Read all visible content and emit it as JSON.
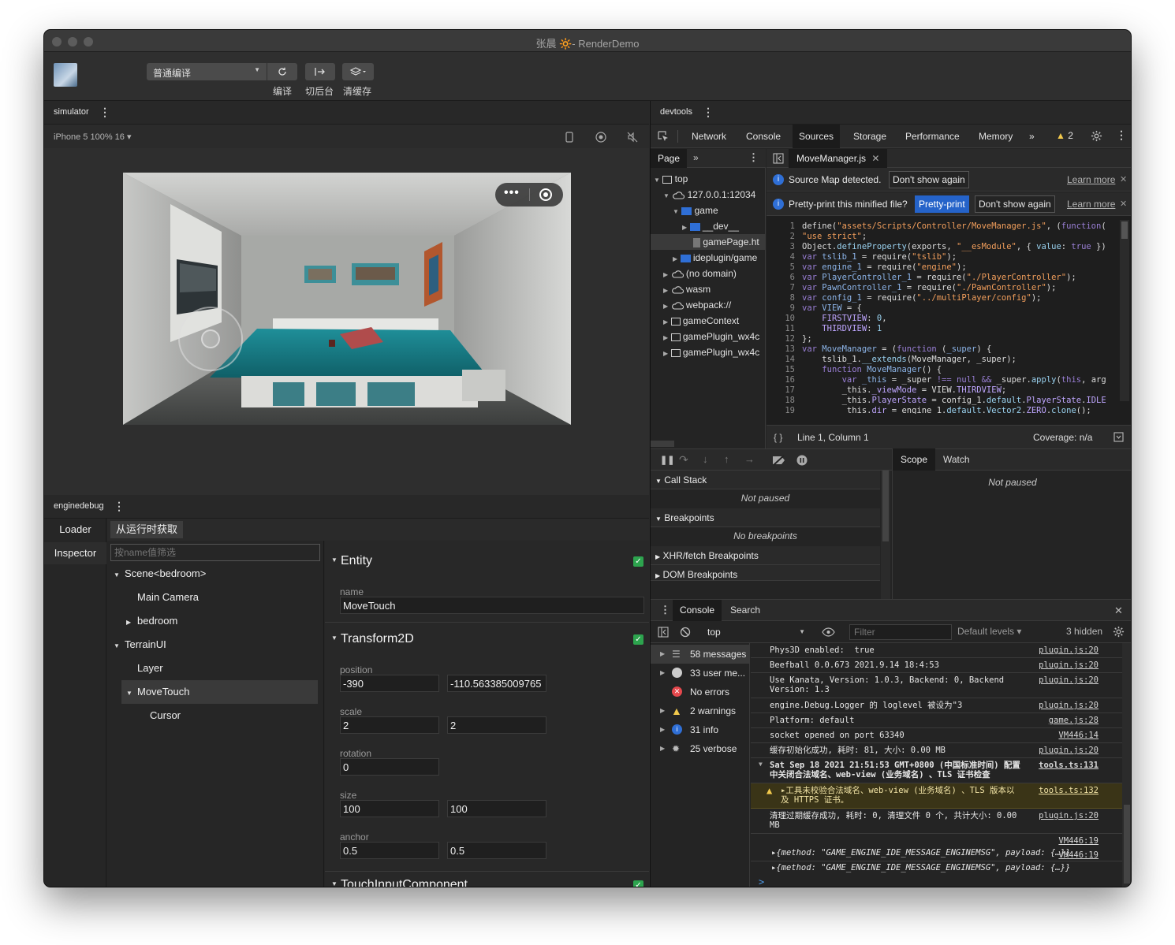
{
  "window": {
    "title": "张晨 🔆- RenderDemo"
  },
  "toolbar": {
    "mode": "普通编译",
    "compile_label": "编译",
    "background_label": "切后台",
    "clear_cache_label": "清缓存"
  },
  "simulator": {
    "panel_title": "simulator",
    "device": "iPhone 5 100% 16 ▾"
  },
  "enginedebug": {
    "panel_title": "enginedebug",
    "tabs": [
      "Loader",
      "Inspector"
    ],
    "fetch_button": "从运行时获取",
    "filter_placeholder": "按name值筛选",
    "tree": [
      {
        "label": "Scene<bedroom>",
        "expanded": true
      },
      {
        "label": "Main Camera"
      },
      {
        "label": "bedroom",
        "expanded": false
      },
      {
        "label": "TerrainUI",
        "expanded": true
      },
      {
        "label": "Layer"
      },
      {
        "label": "MoveTouch",
        "expanded": true,
        "selected": true
      },
      {
        "label": "Cursor"
      }
    ],
    "entity": {
      "title": "Entity",
      "name_label": "name",
      "name_value": "MoveTouch"
    },
    "transform": {
      "title": "Transform2D",
      "position_label": "position",
      "position": [
        "-390",
        "-110.563385009765"
      ],
      "scale_label": "scale",
      "scale": [
        "2",
        "2"
      ],
      "rotation_label": "rotation",
      "rotation": "0",
      "size_label": "size",
      "size": [
        "100",
        "100"
      ],
      "anchor_label": "anchor",
      "anchor": [
        "0.5",
        "0.5"
      ]
    },
    "touch": {
      "title": "TouchInputComponent"
    }
  },
  "devtools": {
    "panel_title": "devtools",
    "tabs": [
      "Network",
      "Console",
      "Sources",
      "Storage",
      "Performance",
      "Memory"
    ],
    "active_tab": "Sources",
    "warning_count": "2",
    "navigator": {
      "tab": "Page",
      "items": [
        {
          "label": "top"
        },
        {
          "label": "127.0.0.1:12034"
        },
        {
          "label": "game"
        },
        {
          "label": "__dev__"
        },
        {
          "label": "gamePage.ht"
        },
        {
          "label": "ideplugin/game"
        },
        {
          "label": "(no domain)"
        },
        {
          "label": "wasm"
        },
        {
          "label": "webpack://"
        },
        {
          "label": "gameContext"
        },
        {
          "label": "gamePlugin_wx4c"
        },
        {
          "label": "gamePlugin_wx4c"
        }
      ]
    },
    "editor": {
      "file_tab": "MoveManager.js",
      "sourcemap_text": "Source Map detected.",
      "dont_show": "Don't show again",
      "learn_more": "Learn more",
      "prettyprint_text": "Pretty-print this minified file?",
      "prettyprint_button": "Pretty-print",
      "status_position": "Line 1, Column 1",
      "coverage": "Coverage: n/a"
    },
    "debugger": {
      "call_stack": "Call Stack",
      "not_paused": "Not paused",
      "breakpoints": "Breakpoints",
      "no_breakpoints": "No breakpoints",
      "xhr_breakpoints": "XHR/fetch Breakpoints",
      "dom_breakpoints": "DOM Breakpoints",
      "scope_tab": "Scope",
      "watch_tab": "Watch",
      "scope_not_paused": "Not paused"
    },
    "console": {
      "tabs": [
        "Console",
        "Search"
      ],
      "context": "top",
      "filter_placeholder": "Filter",
      "levels": "Default levels ▾",
      "hidden": "3 hidden",
      "sidebar": [
        {
          "label": "58 messages",
          "icon": "list-icon"
        },
        {
          "label": "33 user me...",
          "icon": "user-icon"
        },
        {
          "label": "No errors",
          "icon": "error-icon"
        },
        {
          "label": "2 warnings",
          "icon": "warning-icon"
        },
        {
          "label": "31 info",
          "icon": "info-icon"
        },
        {
          "label": "25 verbose",
          "icon": "bug-icon"
        }
      ],
      "messages": [
        {
          "text": "Phys3D enabled:  true",
          "src": "plugin.js:20"
        },
        {
          "text": "Beefball 0.0.673 2021.9.14 18:4:53",
          "src": "plugin.js:20"
        },
        {
          "text": "Use Kanata, Version: 1.0.3, Backend: 0, Backend\nVersion: 1.3",
          "src": "plugin.js:20"
        },
        {
          "text": "engine.Debug.Logger 的 loglevel 被设为\"3",
          "src": "plugin.js:20"
        },
        {
          "text": "Platform: default",
          "src": "game.js:28"
        },
        {
          "text": "socket opened on port 63340",
          "src": "VM446:14"
        },
        {
          "text": "缓存初始化成功, 耗时: 81, 大小: 0.00 MB",
          "src": "plugin.js:20"
        },
        {
          "text": "Sat Sep 18 2021 21:51:53 GMT+0800 (中国标准时间) 配置\n中关闭合法域名、web-view (业务域名) 、TLS 证书检查",
          "src": "tools.ts:131"
        },
        {
          "text": "▸工具未校验合法域名、web-view (业务域名) 、TLS 版本以\n及 HTTPS 证书。",
          "src": "tools.ts:132"
        },
        {
          "text": "清理过期缓存成功, 耗时: 0, 清理文件 0 个, 共计大小: 0.00\nMB",
          "src": "plugin.js:20"
        },
        {
          "text": "▸{method: \"GAME_ENGINE_IDE_MESSAGE_ENGINEMSG\", payload: {…}}",
          "src": "VM446:19"
        },
        {
          "text": "▸{method: \"GAME_ENGINE_IDE_MESSAGE_ENGINEMSG\", payload: {…}}",
          "src": "VM446:19"
        }
      ],
      "prompt": ">"
    }
  }
}
